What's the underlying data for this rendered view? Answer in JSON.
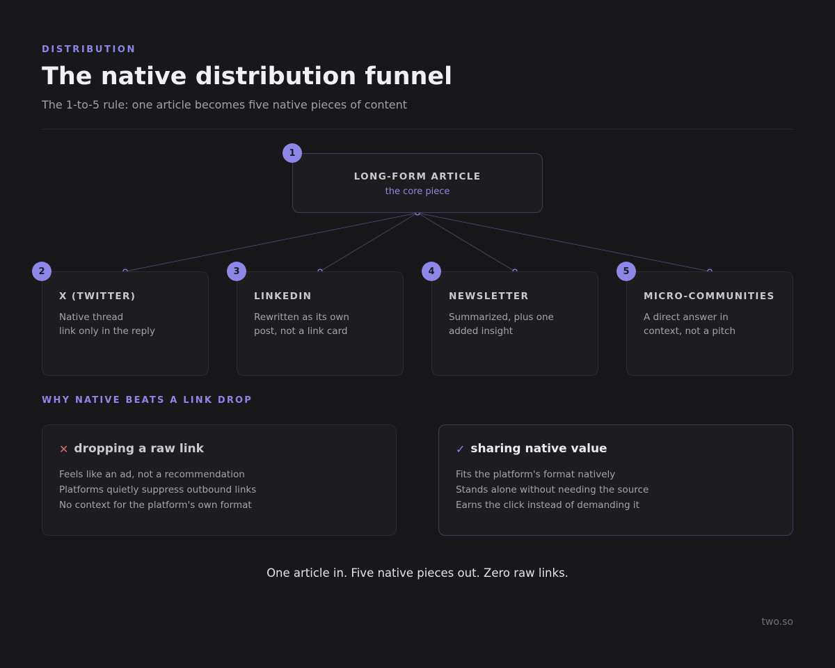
{
  "header": {
    "eyebrow": "DISTRIBUTION",
    "title": "The native distribution funnel",
    "subtitle": "The 1-to-5 rule: one article becomes five native pieces of content"
  },
  "diagram": {
    "root": {
      "number": "1",
      "title": "LONG-FORM ARTICLE",
      "subtitle": "the core piece"
    },
    "children": [
      {
        "number": "2",
        "title": "X (TWITTER)",
        "lines": [
          "Native thread",
          "link only in the reply"
        ]
      },
      {
        "number": "3",
        "title": "LINKEDIN",
        "lines": [
          "Rewritten as its own",
          "post, not a link card"
        ]
      },
      {
        "number": "4",
        "title": "NEWSLETTER",
        "lines": [
          "Summarized, plus one",
          "added insight"
        ]
      },
      {
        "number": "5",
        "title": "MICRO-COMMUNITIES",
        "lines": [
          "A direct answer in",
          "context, not a pitch"
        ]
      }
    ]
  },
  "comparison": {
    "label": "WHY NATIVE BEATS A LINK DROP",
    "bad": {
      "icon": "cross-icon",
      "mark": "✕",
      "title": "dropping a raw link",
      "items": [
        "Feels like an ad, not a recommendation",
        "Platforms quietly suppress outbound links",
        "No context for the platform's own format"
      ]
    },
    "good": {
      "icon": "check-icon",
      "mark": "✓",
      "title": "sharing native value",
      "items": [
        "Fits the platform's format natively",
        "Stands alone without needing the source",
        "Earns the click instead of demanding it"
      ]
    }
  },
  "footer": {
    "tagline": "One article in. Five native pieces out. Zero raw links.",
    "brand": "two.so"
  },
  "colors": {
    "background": "#18181b",
    "accent": "#8d86e6",
    "negative": "#e06a6a",
    "card": "#1d1d21"
  }
}
